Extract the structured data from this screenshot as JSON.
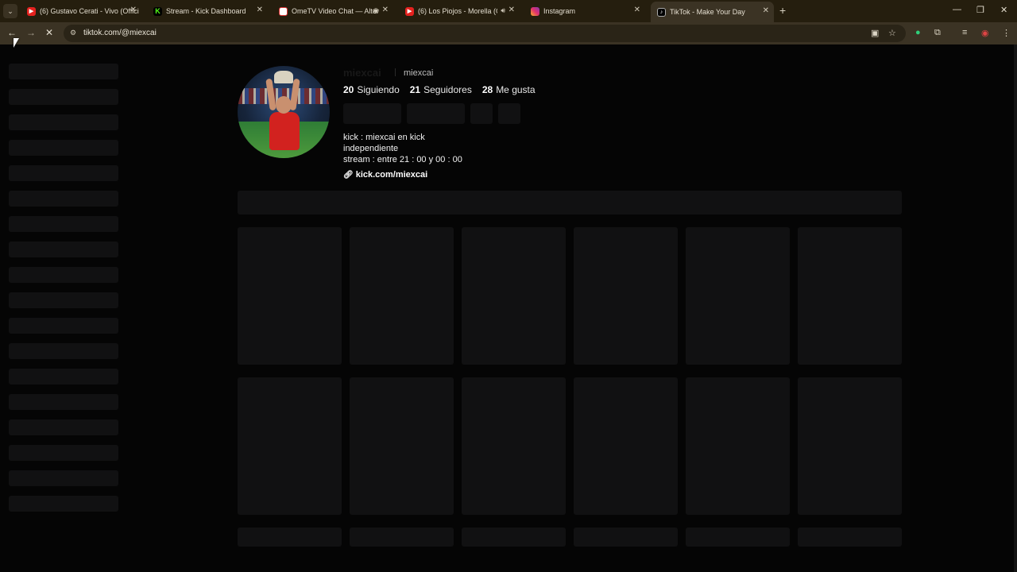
{
  "browser": {
    "tabs": [
      {
        "title": "(6) Gustavo Cerati - Vivo (Offici",
        "favicon": "youtube-icon",
        "active": false
      },
      {
        "title": "Stream - Kick Dashboard",
        "favicon": "kick-icon",
        "active": false
      },
      {
        "title": "OmeTV Video Chat — Alter",
        "favicon": "ometv-icon",
        "active": false
      },
      {
        "title": "(6) Los Piojos - Morella (Co",
        "favicon": "youtube-icon",
        "active": false
      },
      {
        "title": "Instagram",
        "favicon": "instagram-icon",
        "active": false
      },
      {
        "title": "TikTok - Make Your Day",
        "favicon": "tiktok-icon",
        "active": true
      }
    ],
    "url": "tiktok.com/@miexcai",
    "colors": {
      "tabstrip": "#251e0e",
      "toolbar": "#3b3324",
      "page": "#050505"
    }
  },
  "profile": {
    "username": "miexcai",
    "nickname": "miexcai",
    "stats": [
      {
        "count": "20",
        "label": "Siguiendo"
      },
      {
        "count": "21",
        "label": "Seguidores"
      },
      {
        "count": "28",
        "label": "Me gusta"
      }
    ],
    "bio_lines": [
      "kick : miexcai en kick",
      "independiente",
      "stream : entre 21 : 00 y 00 : 00"
    ],
    "link": "kick.com/miexcai"
  }
}
